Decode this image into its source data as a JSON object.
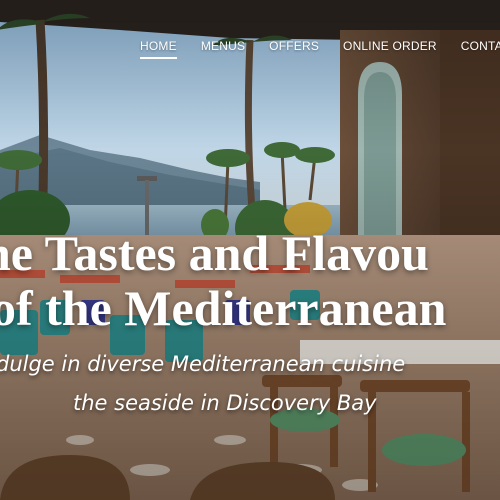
{
  "nav": {
    "items": [
      {
        "label": "HOME",
        "active": true
      },
      {
        "label": "MENUS",
        "active": false
      },
      {
        "label": "OFFERS",
        "active": false
      },
      {
        "label": "ONLINE ORDER",
        "active": false
      },
      {
        "label": "CONTACT",
        "active": false
      }
    ]
  },
  "hero": {
    "headline_line1": "he Tastes and Flavou",
    "headline_line2": "of the Mediterranean",
    "tagline_line1": "dulge in diverse Mediterranean cuisine",
    "tagline_line2": "the seaside in Discovery Bay"
  }
}
